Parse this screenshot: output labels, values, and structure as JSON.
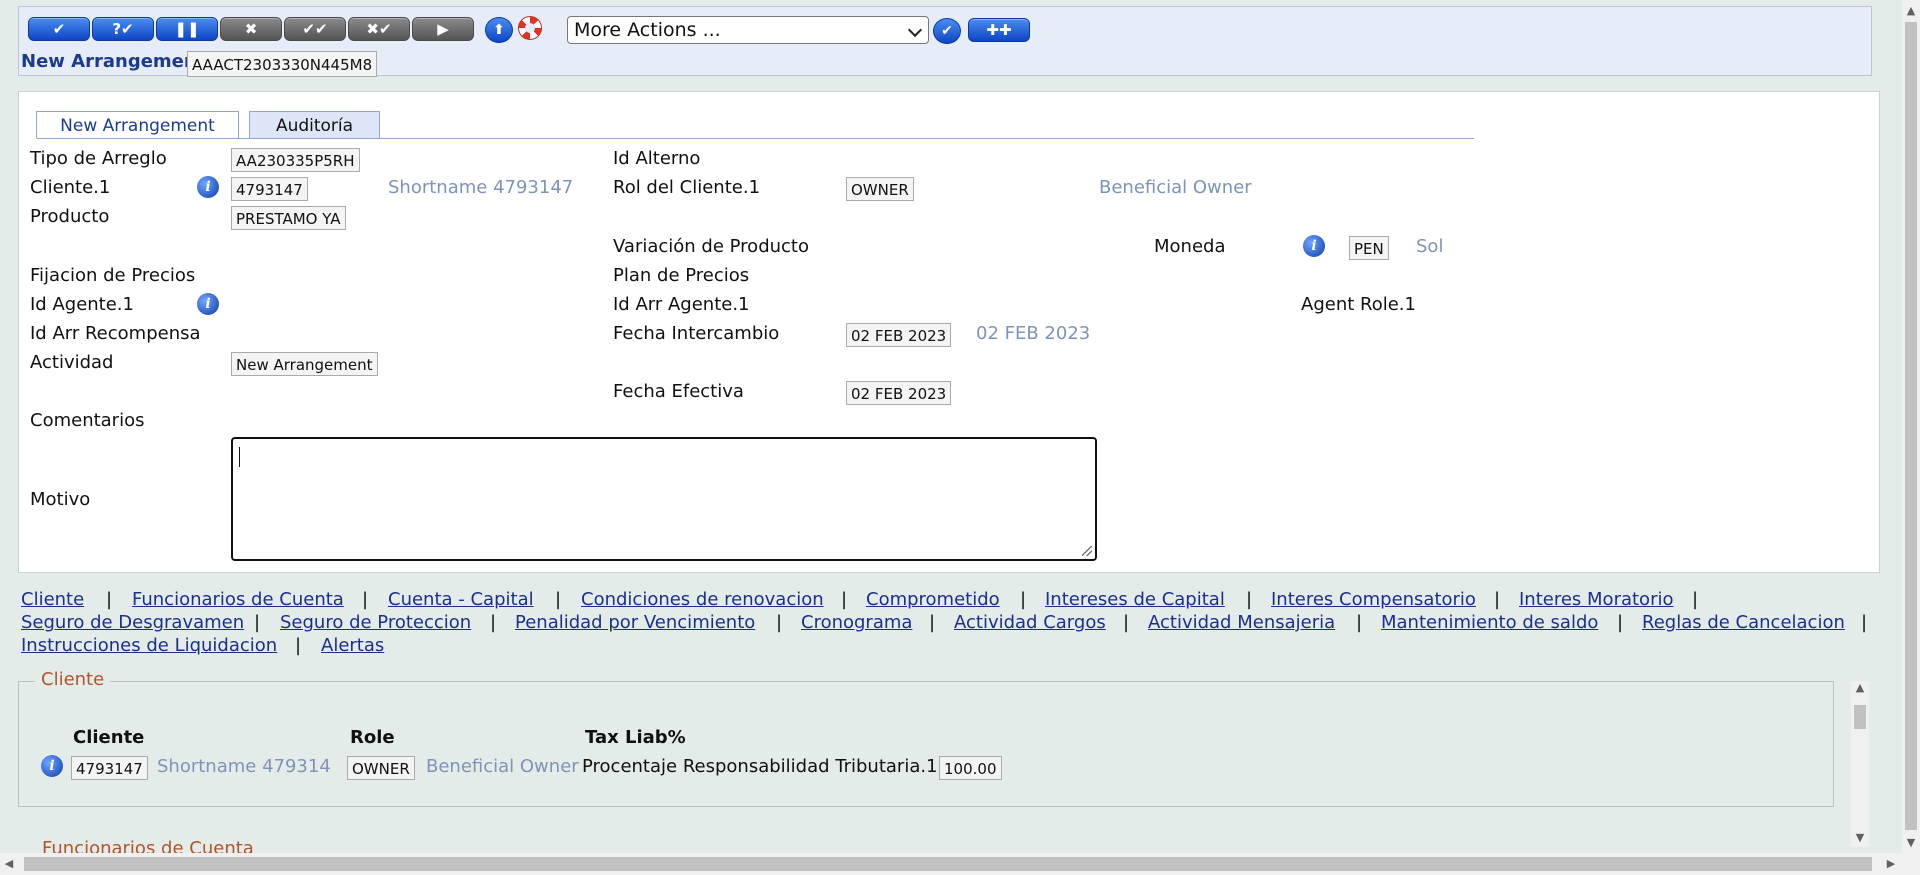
{
  "toolbar": {
    "buttons": [
      {
        "name": "commit",
        "label": "✔"
      },
      {
        "name": "validate",
        "label": "?✔"
      },
      {
        "name": "hold",
        "label": "❚❚"
      },
      {
        "name": "delete",
        "label": "✖"
      },
      {
        "name": "authorise",
        "label": "✔✔"
      },
      {
        "name": "reverse",
        "label": "✖✔"
      },
      {
        "name": "next",
        "label": "▶"
      }
    ],
    "more_actions": "More Actions ...",
    "transaction_label": "New Arrangement",
    "transaction_id": "AAACT2303330N445M8"
  },
  "tabs": [
    "New Arrangement",
    "Auditoría"
  ],
  "form": {
    "tipo_label": "Tipo de Arreglo",
    "tipo_value": "AA230335P5RH",
    "cliente_label": "Cliente.1",
    "cliente_value": "4793147",
    "cliente_enrich": "Shortname 4793147",
    "producto_label": "Producto",
    "producto_value": "PRESTAMO YA",
    "fijacion_label": "Fijacion de Precios",
    "agente_label": "Id Agente.1",
    "recompensa_label": "Id Arr Recompensa",
    "actividad_label": "Actividad",
    "actividad_value": "New Arrangement",
    "comentarios_label": "Comentarios",
    "motivo_label": "Motivo",
    "alterno_label": "Id Alterno",
    "rol_label": "Rol del Cliente.1",
    "rol_value": "OWNER",
    "rol_enrich": "Beneficial Owner",
    "variacion_label": "Variación de Producto",
    "moneda_label": "Moneda",
    "moneda_value": "PEN",
    "moneda_enrich": "Sol",
    "plan_label": "Plan de Precios",
    "arr_agente_label": "Id Arr Agente.1",
    "agent_role_label": "Agent Role.1",
    "intercambio_label": "Fecha Intercambio",
    "intercambio_value": "02 FEB 2023",
    "intercambio_enrich": "02 FEB 2023",
    "efectiva_label": "Fecha Efectiva",
    "efectiva_value": "02 FEB 2023"
  },
  "links": {
    "row1": [
      "Cliente",
      "Funcionarios de Cuenta",
      "Cuenta - Capital",
      "Condiciones de renovacion",
      "Comprometido",
      "Intereses de Capital",
      "Interes Compensatorio",
      "Interes Moratorio"
    ],
    "row2": [
      "Seguro de Desgravamen",
      "Seguro de Proteccion",
      "Penalidad por Vencimiento",
      "Cronograma",
      "Actividad Cargos",
      "Actividad Mensajeria",
      "Mantenimiento de saldo",
      "Reglas de Cancelacion"
    ],
    "row3": [
      "Instrucciones de Liquidacion",
      "Alertas"
    ],
    "separator": "|"
  },
  "cliente_section": {
    "legend": "Cliente",
    "col_cliente": "Cliente",
    "col_role": "Role",
    "col_tax": "Tax Liab%",
    "cliente_value": "4793147",
    "cliente_enrich": "Shortname 479314",
    "role_value": "OWNER",
    "role_enrich": "Beneficial Owner",
    "tax_label": "Procentaje Responsabilidad Tributaria.1",
    "tax_value": "100.00"
  },
  "next_section_legend": "Funcionarios de Cuenta"
}
